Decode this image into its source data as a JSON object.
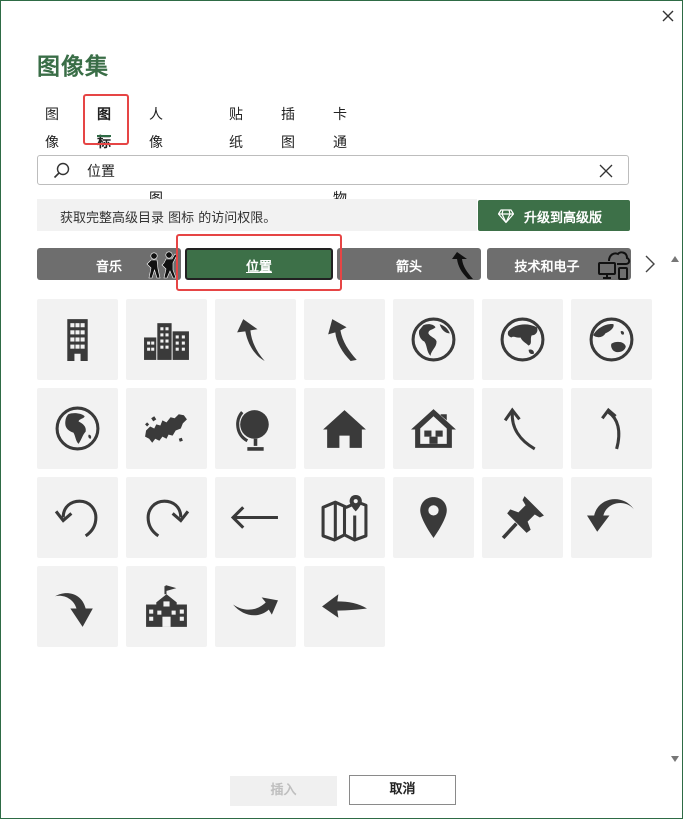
{
  "dialog": {
    "title": "图像集",
    "close_icon": "close-icon"
  },
  "tabs": [
    {
      "label": "图像",
      "active": false
    },
    {
      "label": "图标",
      "active": true
    },
    {
      "label": "人像抠图",
      "active": false
    },
    {
      "label": "贴纸",
      "active": false
    },
    {
      "label": "插图",
      "active": false
    },
    {
      "label": "卡通人物",
      "active": false
    }
  ],
  "search": {
    "value": "位置",
    "placeholder": ""
  },
  "banner": {
    "text": "获取完整高级目录 图标 的访问权限。",
    "upgrade_label": "升级到高级版"
  },
  "categories": [
    {
      "label": "音乐",
      "icon": "dancing-people-icon"
    },
    {
      "label": "位置",
      "icon": "",
      "selected": true
    },
    {
      "label": "箭头",
      "icon": "curved-arrow-icon"
    },
    {
      "label": "技术和电子",
      "icon": "cloud-devices-icon"
    }
  ],
  "icons": [
    "office-building-icon",
    "city-buildings-icon",
    "curved-arrow-up-icon",
    "curved-arrow-up-left-icon",
    "globe-americas-icon",
    "globe-asia-icon",
    "globe-australia-icon",
    "globe-africa-icon",
    "europe-map-icon",
    "desk-globe-icon",
    "house-icon",
    "house-outline-icon",
    "thin-curved-arrow-left-icon",
    "thin-curved-arrow-right-icon",
    "undo-arrow-icon",
    "redo-arrow-icon",
    "left-arrow-icon",
    "folded-map-icon",
    "map-pin-icon",
    "push-pin-icon",
    "curved-arrow-down-left-icon",
    "curved-arrow-down-right-icon",
    "school-building-icon",
    "swoosh-arrow-right-icon",
    "swoosh-arrow-left-icon"
  ],
  "footer": {
    "insert_label": "插入",
    "cancel_label": "取消"
  },
  "colors": {
    "accent": "#3d7048",
    "category_bg": "#6e6e6e",
    "highlight": "#e64545",
    "icon": "#3a3a3a"
  }
}
